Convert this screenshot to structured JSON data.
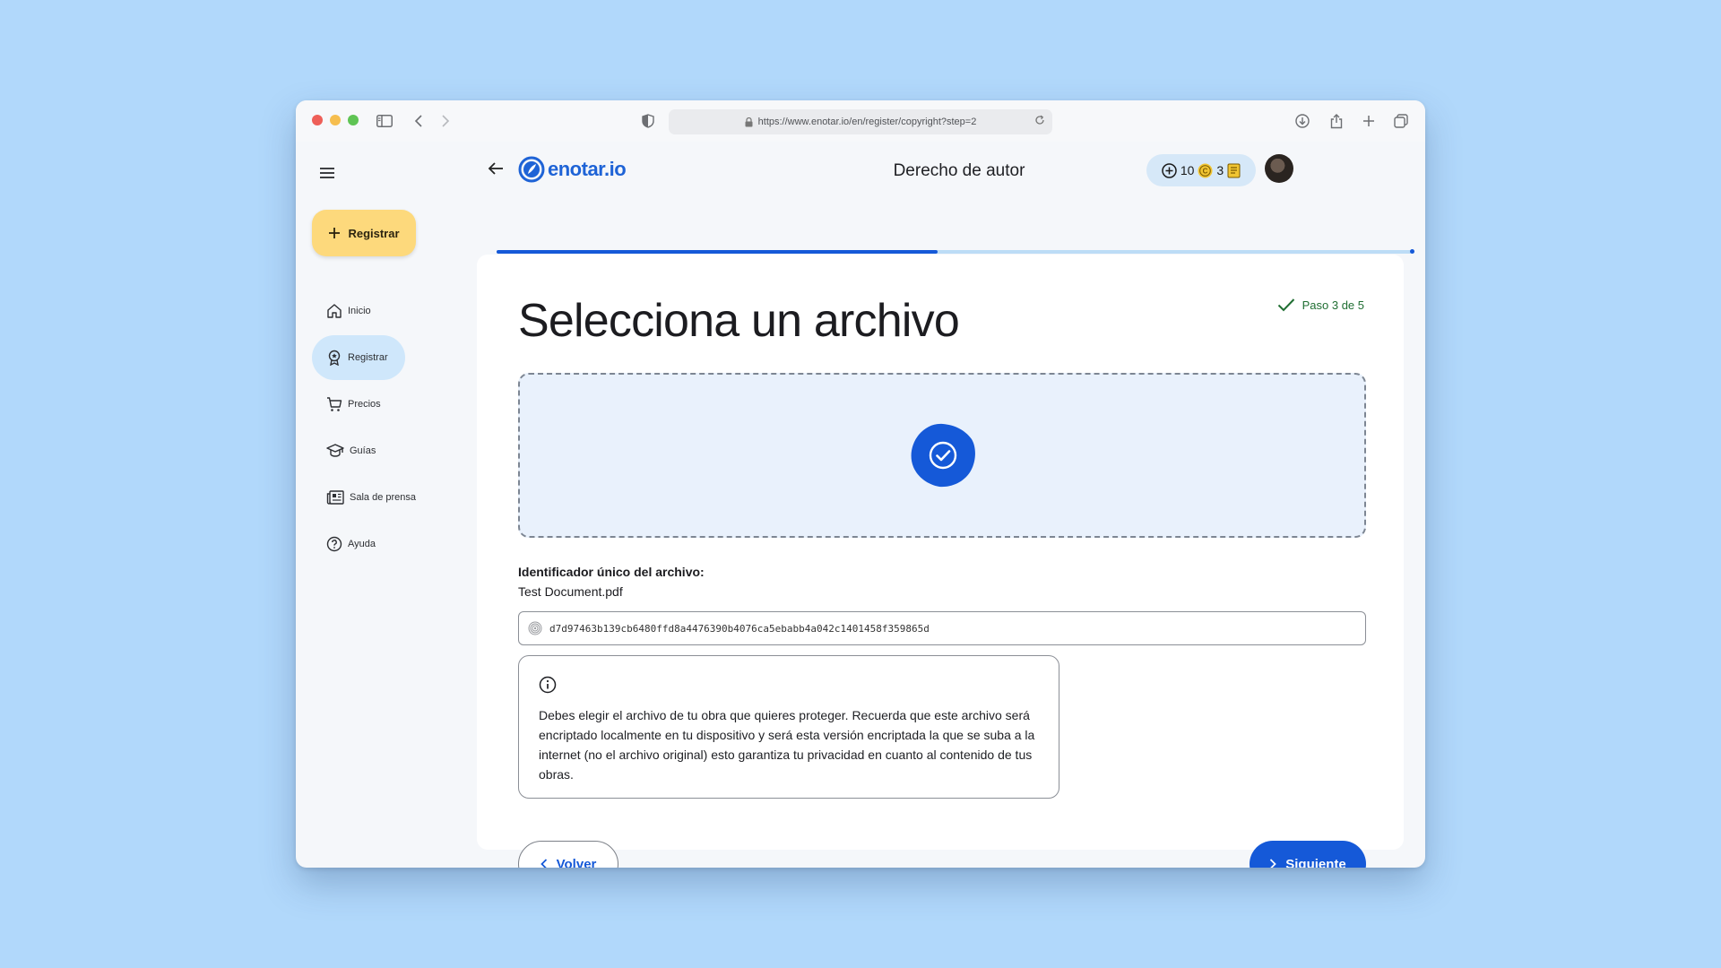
{
  "browser": {
    "url": "https://www.enotar.io/en/register/copyright?step=2"
  },
  "sidebar": {
    "new_button_label": "Registrar",
    "items": [
      {
        "label": "Inicio",
        "icon": "home-icon"
      },
      {
        "label": "Registrar",
        "icon": "award-icon",
        "active": true
      },
      {
        "label": "Precios",
        "icon": "cart-icon"
      },
      {
        "label": "Guías",
        "icon": "graduation-cap-icon"
      },
      {
        "label": "Sala de prensa",
        "icon": "newspaper-icon"
      },
      {
        "label": "Ayuda",
        "icon": "help-circle-icon"
      }
    ]
  },
  "header": {
    "logo_text": "enotar.io",
    "title": "Derecho de autor",
    "credits_count": "10",
    "coins_count": "3",
    "progress_fraction": 0.48
  },
  "main": {
    "step_label": "Paso 3 de 5",
    "title": "Selecciona un archivo",
    "id_label": "Identificador único del archivo:",
    "file_name": "Test Document.pdf",
    "file_hash": "d7d97463b139cb6480ffd8a4476390b4076ca5ebabb4a042c1401458f359865d",
    "info_text": "Debes elegir el archivo de tu obra que quieres proteger. Recuerda que este archivo será encriptado localmente en tu dispositivo y será esta versión encriptada la que se suba a la internet (no el archivo original) esto garantiza tu privacidad en cuanto al contenido de tus obras.",
    "back_label": "Volver",
    "next_label": "Siguiente"
  },
  "colors": {
    "accent": "#1559d8",
    "new_button": "#fdd97c",
    "active_nav": "#cfe7fb",
    "dropzone": "#e9f1fc",
    "background": "#b1d8fb"
  }
}
